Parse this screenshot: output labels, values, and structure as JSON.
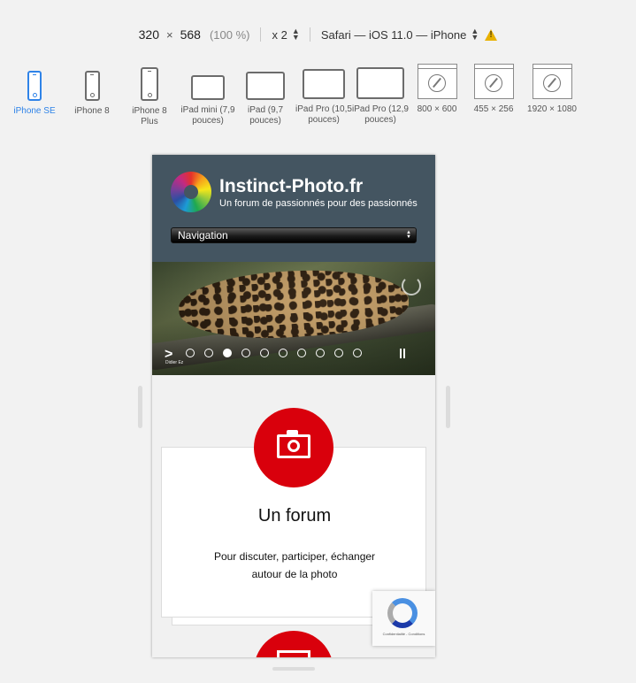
{
  "toolbar": {
    "width": "320",
    "times": "×",
    "height": "568",
    "zoom": "(100 %)",
    "scale": "x 2",
    "user_agent": "Safari — iOS 11.0 — iPhone"
  },
  "devices": [
    {
      "label": "iPhone SE",
      "icon": "phone-icon",
      "active": true
    },
    {
      "label": "iPhone 8",
      "icon": "phone-icon"
    },
    {
      "label": "iPhone 8 Plus",
      "icon": "phone-icon"
    },
    {
      "label": "iPad mini (7,9 pouces)",
      "icon": "tablet-icon"
    },
    {
      "label": "iPad (9,7 pouces)",
      "icon": "tablet-icon"
    },
    {
      "label": "iPad Pro (10,5 pouces)",
      "icon": "tablet-icon"
    },
    {
      "label": "iPad Pro (12,9 pouces)",
      "icon": "tablet-icon"
    },
    {
      "label": "800 × 600",
      "icon": "safari-window-icon"
    },
    {
      "label": "455 × 256",
      "icon": "safari-window-icon"
    },
    {
      "label": "1920 × 1080",
      "icon": "safari-window-icon"
    }
  ],
  "site": {
    "title": "Instinct-Photo.fr",
    "tagline": "Un forum de passionnés pour des passionnés",
    "nav_label": "Navigation",
    "slider_credit": "Didier Ez",
    "card": {
      "title": "Un forum",
      "line1": "Pour discuter, participer, échanger",
      "line2": "autour de la photo"
    },
    "recaptcha_text": "Confidentialité - Conditions"
  },
  "colors": {
    "active_device": "#2f83e8",
    "header_bg": "#445561",
    "badge_red": "#d9000c"
  }
}
